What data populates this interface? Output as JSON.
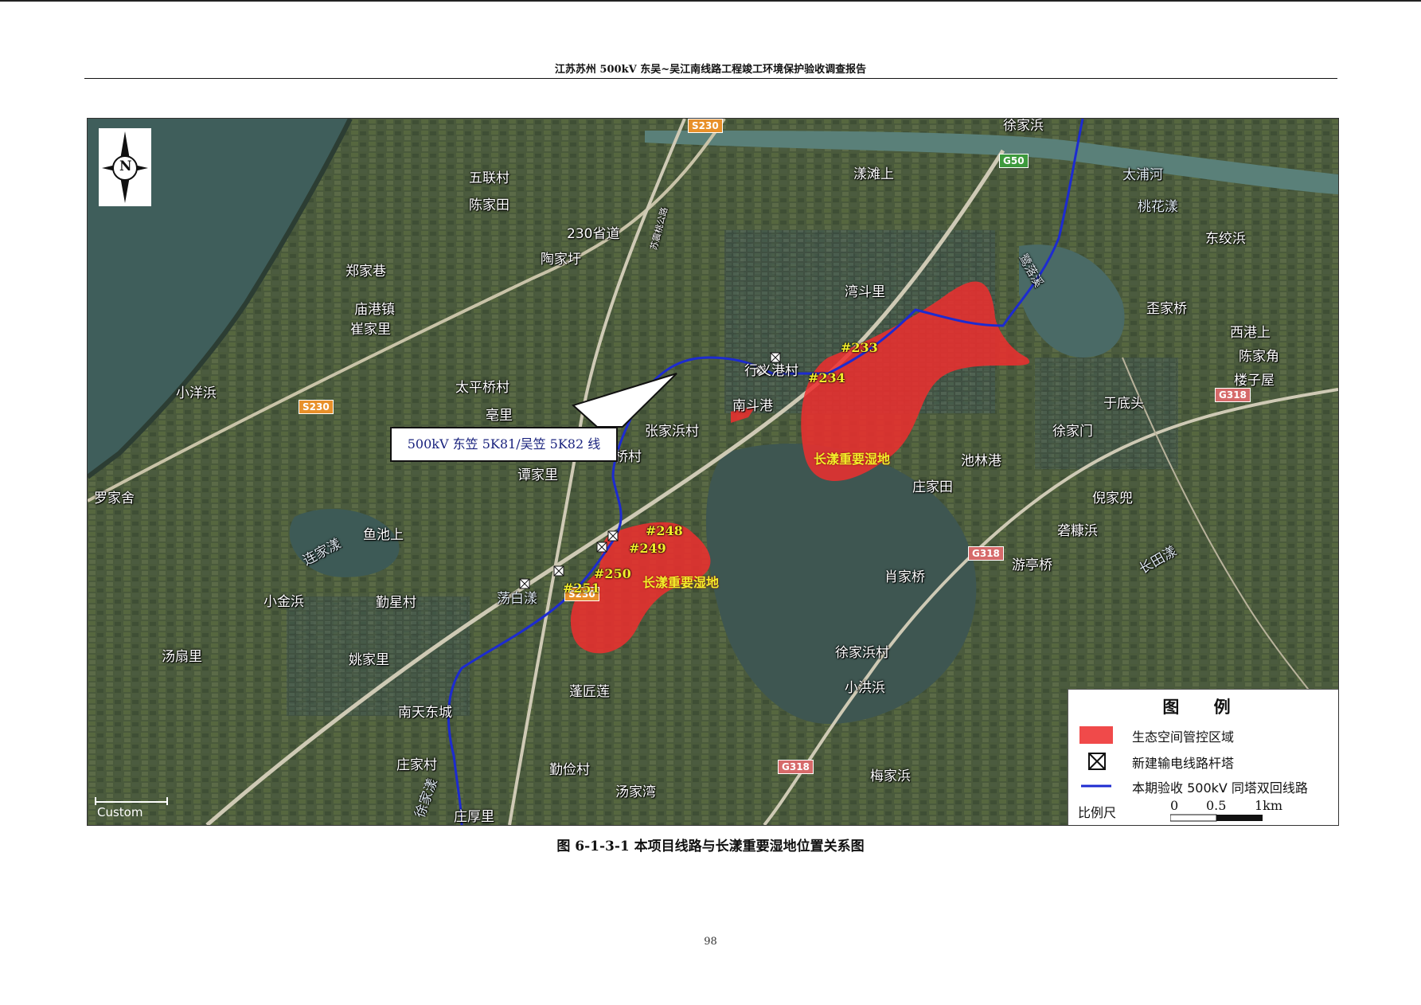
{
  "header": {
    "title": "江苏苏州 500kV 东吴~吴江南线路工程竣工环境保护验收调查报告"
  },
  "map": {
    "road_shields": [
      "S230",
      "G50",
      "S230",
      "G318",
      "G318",
      "G318",
      "S230"
    ],
    "places": [
      "五联村",
      "陈家田",
      "230省道",
      "陶家圩",
      "郑家巷",
      "庙港镇",
      "崔家里",
      "小洋浜",
      "太平桥村",
      "亳里",
      "罗家舍",
      "谭家里",
      "连家漾",
      "鱼池上",
      "小金浜",
      "勤星村",
      "荡白漾",
      "汤扇里",
      "姚家里",
      "南天东城",
      "庄家村",
      "蓬匠莲",
      "勤俭村",
      "汤家湾",
      "庄厚里",
      "徐家漾",
      "漾滩上",
      "湾斗里",
      "行义港村",
      "南斗港",
      "张家浜村",
      "桥村",
      "太浦河",
      "桃花漾",
      "东绞浜",
      "歪家桥",
      "西港上",
      "陈家角",
      "楼子屋",
      "于底头",
      "徐家门",
      "池林港",
      "庄家田",
      "倪家兜",
      "砻糠浜",
      "游亭桥",
      "长田漾",
      "肖家桥",
      "徐家浜村",
      "小洪浜",
      "梅家浜",
      "苏震桃公路",
      "鹭落溪",
      "徐家浜"
    ],
    "towers": [
      "#233",
      "#234",
      "#248",
      "#249",
      "#250",
      "#251"
    ],
    "wetland_labels": [
      "长漾重要湿地",
      "长漾重要湿地"
    ],
    "callout": "500kV 东笠 5K81/吴笠 5K82 线",
    "north_label": "N",
    "scale_corner": "Custom",
    "legend": {
      "title": "图 例",
      "items": [
        {
          "label": "生态空间管控区域",
          "color": "#f04a4a"
        },
        {
          "label": "新建输电线路杆塔"
        },
        {
          "label": "本期验收 500kV 同塔双回线路",
          "color": "#1d2bd0"
        }
      ],
      "scale_label": "比例尺",
      "scale_values": [
        "0",
        "0.5",
        "1km"
      ]
    }
  },
  "caption": "图 6-1-3-1 本项目线路与长漾重要湿地位置关系图",
  "page_number": "98"
}
